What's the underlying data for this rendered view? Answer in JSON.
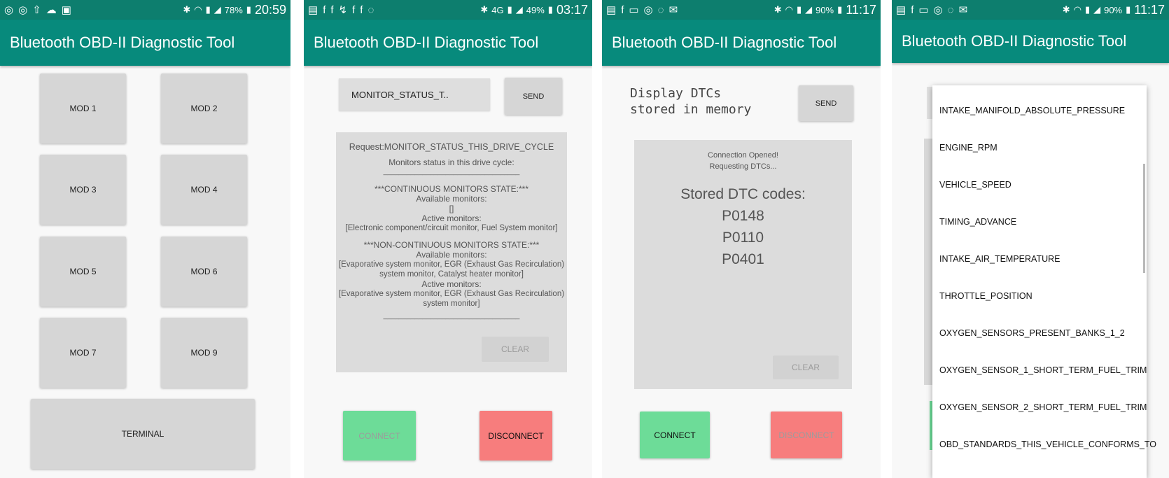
{
  "screens": [
    {
      "status": {
        "battery": "78%",
        "time": "20:59"
      },
      "app_title": "Bluetooth OBD-II Diagnostic Tool",
      "mods": [
        "MOD 1",
        "MOD 2",
        "MOD 3",
        "MOD 4",
        "MOD 5",
        "MOD 6",
        "MOD 7",
        "MOD 9"
      ],
      "terminal_label": "TERMINAL"
    },
    {
      "status": {
        "network": "4G",
        "battery": "49%",
        "time": "03:17"
      },
      "app_title": "Bluetooth OBD-II Diagnostic Tool",
      "command_value": "MONITOR_STATUS_T..",
      "send_label": "SEND",
      "output_lines": [
        "Request:MONITOR_STATUS_THIS_DRIVE_CYCLE",
        "",
        "Monitors status in this drive cycle:",
        "___________________________________",
        "",
        "***CONTINUOUS MONITORS STATE:***",
        "Available monitors:",
        "[]",
        "Active monitors:",
        "[Electronic component/circuit monitor, Fuel System monitor]",
        "",
        "***NON-CONTINUOUS MONITORS STATE:***",
        "Available monitors:",
        "[Evaporative system monitor, EGR (Exhaust Gas Recirculation)",
        "system monitor, Catalyst heater monitor]",
        "Active monitors:",
        "[Evaporative system monitor, EGR (Exhaust Gas Recirculation)",
        "system monitor]",
        "",
        "___________________________________"
      ],
      "clear_label": "CLEAR",
      "connect_label": "CONNECT",
      "disconnect_label": "DISCONNECT"
    },
    {
      "status": {
        "battery": "90%",
        "time": "11:17"
      },
      "app_title": "Bluetooth OBD-II Diagnostic Tool",
      "command_lines": [
        "Display DTCs",
        "stored in memory"
      ],
      "send_label": "SEND",
      "info_lines": [
        "Connection Opened!",
        "Requesting DTCs..."
      ],
      "dtc_title": "Stored DTC codes:",
      "dtc_codes": [
        "P0148",
        "P0110",
        "P0401"
      ],
      "clear_label": "CLEAR",
      "connect_label": "CONNECT",
      "disconnect_label": "DISCONNECT"
    },
    {
      "status": {
        "battery": "90%",
        "time": "11:17"
      },
      "app_title": "Bluetooth OBD-II Diagnostic Tool",
      "options": [
        "INTAKE_MANIFOLD_ABSOLUTE_PRESSURE",
        "ENGINE_RPM",
        "VEHICLE_SPEED",
        "TIMING_ADVANCE",
        "INTAKE_AIR_TEMPERATURE",
        "THROTTLE_POSITION",
        "OXYGEN_SENSORS_PRESENT_BANKS_1_2",
        "OXYGEN_SENSOR_1_SHORT_TERM_FUEL_TRIM",
        "OXYGEN_SENSOR_2_SHORT_TERM_FUEL_TRIM",
        "OBD_STANDARDS_THIS_VEHICLE_CONFORMS_TO"
      ]
    }
  ]
}
